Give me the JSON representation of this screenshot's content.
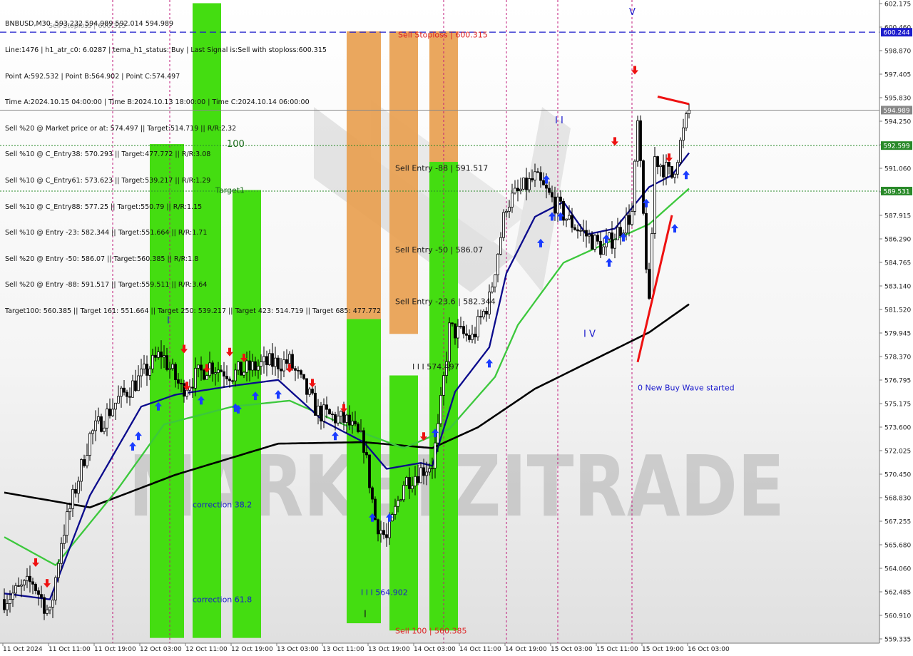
{
  "header": {
    "lines": [
      "BNBUSD,M30  593.232 594.989 592.014 594.989",
      "Line:1476 | h1_atr_c0: 6.0287 | tema_h1_status: Buy | Last Signal is:Sell with stoploss:600.315",
      "Point A:592.532 | Point B:564.902 | Point C:574.497",
      "Time A:2024.10.15 04:00:00 | Time B:2024.10.13 18:00:00 | Time C:2024.10.14 06:00:00",
      "Sell %20 @ Market price or at: 574.497 || Target:514.719 || R/R:2.32",
      "Sell %10 @ C_Entry38: 570.293 || Target:477.772 || R/R:3.08",
      "Sell %10 @ C_Entry61: 573.623 || Target:539.217 || R/R:1.29",
      "Sell %10 @ C_Entry88: 577.25 || Target:550.79 || R/R:1.15",
      "Sell %10 @ Entry -23: 582.344 || Target:551.664 || R/R:1.71",
      "Sell %20 @ Entry -50: 586.07 || Target:560.385 || R/R:1.8",
      "Sell %20 @ Entry -88: 591.517 || Target:559.511 || R/R:3.64",
      "Target100: 560.385 || Target 161: 551.664 || Target 250: 539.217 || Target 423: 514.719 || Target 685: 477.772"
    ],
    "overlay_text": "Sell Stoploss | 600.315"
  },
  "watermark": "MARKETZITRADE",
  "colors": {
    "up": "#000000",
    "down": "#000000",
    "ema_fast": "#0a0a8c",
    "ema_mid": "#3cc83c",
    "ema_slow": "#000000",
    "green_box": "#44dd11",
    "orange_box": "#e8a050",
    "buy_arrow": "#1a3cff",
    "sell_arrow": "#ee1111",
    "hline_blue": "#1c1ccc",
    "hline_green": "#2a8a2a"
  },
  "chart_data": {
    "type": "candlestick",
    "symbol": "BNBUSD",
    "timeframe": "M30",
    "ylim": [
      559.335,
      602.175
    ],
    "y_ticks": [
      "602.175",
      "600.460",
      "598.870",
      "597.405",
      "595.830",
      "594.250",
      "592.635",
      "591.060",
      "589.480",
      "587.915",
      "586.290",
      "584.765",
      "583.140",
      "581.520",
      "579.945",
      "578.370",
      "576.795",
      "575.175",
      "573.600",
      "572.025",
      "570.450",
      "568.830",
      "567.255",
      "565.680",
      "564.060",
      "562.485",
      "560.910",
      "559.335"
    ],
    "x_labels": [
      "11 Oct 2024",
      "11 Oct 11:00",
      "11 Oct 19:00",
      "12 Oct 03:00",
      "12 Oct 11:00",
      "12 Oct 19:00",
      "13 Oct 03:00",
      "13 Oct 11:00",
      "13 Oct 19:00",
      "14 Oct 03:00",
      "14 Oct 11:00",
      "14 Oct 19:00",
      "15 Oct 03:00",
      "15 Oct 11:00",
      "15 Oct 19:00",
      "16 Oct 03:00"
    ],
    "candle_count": 241,
    "price_path": [
      [
        0,
        562.0
      ],
      [
        10,
        563.2
      ],
      [
        16,
        560.9
      ],
      [
        20,
        566.0
      ],
      [
        30,
        573.0
      ],
      [
        40,
        575.5
      ],
      [
        48,
        577.0
      ],
      [
        55,
        578.6
      ],
      [
        62,
        576.2
      ],
      [
        72,
        577.8
      ],
      [
        80,
        577.2
      ],
      [
        92,
        577.9
      ],
      [
        100,
        578.0
      ],
      [
        110,
        574.6
      ],
      [
        120,
        574.0
      ],
      [
        126,
        572.5
      ],
      [
        130,
        567.4
      ],
      [
        134,
        566.0
      ],
      [
        140,
        569.9
      ],
      [
        150,
        571.2
      ],
      [
        152,
        573.4
      ],
      [
        156,
        580.2
      ],
      [
        164,
        579.6
      ],
      [
        170,
        582.2
      ],
      [
        176,
        588.7
      ],
      [
        186,
        590.4
      ],
      [
        198,
        587.5
      ],
      [
        210,
        585.6
      ],
      [
        220,
        588.0
      ],
      [
        222,
        594.0
      ],
      [
        226,
        581.6
      ],
      [
        228,
        591.8
      ],
      [
        234,
        590.5
      ],
      [
        240,
        594.989
      ]
    ],
    "ema_fast": [
      [
        0,
        562.4
      ],
      [
        16,
        562.0
      ],
      [
        30,
        569.0
      ],
      [
        48,
        575.0
      ],
      [
        60,
        575.8
      ],
      [
        80,
        576.4
      ],
      [
        96,
        576.8
      ],
      [
        112,
        574.0
      ],
      [
        126,
        572.6
      ],
      [
        134,
        570.8
      ],
      [
        146,
        571.2
      ],
      [
        150,
        571.0
      ],
      [
        158,
        576.0
      ],
      [
        170,
        579.0
      ],
      [
        176,
        584.0
      ],
      [
        186,
        587.8
      ],
      [
        196,
        588.8
      ],
      [
        204,
        586.6
      ],
      [
        214,
        587.0
      ],
      [
        226,
        589.8
      ],
      [
        234,
        590.6
      ],
      [
        240,
        592.1
      ]
    ],
    "ema_mid": [
      [
        0,
        566.2
      ],
      [
        18,
        564.3
      ],
      [
        40,
        569.5
      ],
      [
        56,
        573.8
      ],
      [
        80,
        575.0
      ],
      [
        100,
        575.4
      ],
      [
        126,
        573.2
      ],
      [
        140,
        572.2
      ],
      [
        156,
        573.5
      ],
      [
        172,
        577.0
      ],
      [
        180,
        580.5
      ],
      [
        196,
        584.7
      ],
      [
        212,
        586.1
      ],
      [
        226,
        587.3
      ],
      [
        240,
        589.7
      ]
    ],
    "ema_slow": [
      [
        0,
        569.2
      ],
      [
        30,
        568.2
      ],
      [
        60,
        570.4
      ],
      [
        96,
        572.5
      ],
      [
        126,
        572.6
      ],
      [
        150,
        572.2
      ],
      [
        166,
        573.6
      ],
      [
        186,
        576.2
      ],
      [
        206,
        578.1
      ],
      [
        226,
        580.0
      ],
      [
        240,
        581.9
      ]
    ],
    "green_boxes": [
      {
        "x0": 51,
        "x1": 63,
        "top": 592.7,
        "bottom": 559.4
      },
      {
        "x0": 66,
        "x1": 76,
        "top": 602.2,
        "bottom": 559.4
      },
      {
        "x0": 80,
        "x1": 90,
        "top": 589.6,
        "bottom": 559.4
      },
      {
        "x0": 120,
        "x1": 132,
        "top": 580.9,
        "bottom": 560.39
      },
      {
        "x0": 135,
        "x1": 145,
        "top": 577.1,
        "bottom": 559.9
      },
      {
        "x0": 149,
        "x1": 159,
        "top": 591.5,
        "bottom": 559.9
      }
    ],
    "orange_boxes": [
      {
        "x0": 120,
        "x1": 132,
        "top": 600.3,
        "bottom": 580.9
      },
      {
        "x0": 135,
        "x1": 145,
        "top": 600.3,
        "bottom": 579.9
      },
      {
        "x0": 149,
        "x1": 159,
        "top": 600.3,
        "bottom": 591.5
      }
    ],
    "hlines": [
      {
        "y": 600.244,
        "label": "600.244",
        "style": "dashed",
        "color": "#1c1ccc"
      },
      {
        "y": 594.989,
        "label": "594.989",
        "style": "solid",
        "color": "#888888"
      },
      {
        "y": 592.599,
        "label": "592.599",
        "style": "dotted",
        "color": "#2a8a2a"
      },
      {
        "y": 589.531,
        "label": "589.531",
        "style": "dotted",
        "color": "#2a8a2a"
      }
    ],
    "vlines_index": [
      38,
      58,
      154,
      176,
      194,
      220
    ],
    "annotations": [
      {
        "text": "Sell Stoploss | 600.315",
        "x": 138,
        "y": 599.9,
        "color": "#dd2222"
      },
      {
        "text": "100",
        "x": 78,
        "y": 592.5,
        "color": "#1a6b1a"
      },
      {
        "text": "Target1",
        "x": 74,
        "y": 589.4,
        "color": "#1a6b1a"
      },
      {
        "text": "Sell Entry -88 | 591.517",
        "x": 137,
        "y": 590.9,
        "color": "#1a1a1a"
      },
      {
        "text": "Sell Entry -50 | 586.07",
        "x": 137,
        "y": 585.4,
        "color": "#1a1a1a"
      },
      {
        "text": "Sell Entry -23.6 | 582.344",
        "x": 137,
        "y": 581.9,
        "color": "#1a1a1a"
      },
      {
        "text": "I I I 574.497",
        "x": 143,
        "y": 577.5,
        "color": "#1a1a1a"
      },
      {
        "text": "correction 38.2",
        "x": 66,
        "y": 568.2,
        "color": "#1a1acc"
      },
      {
        "text": "correction 61.8",
        "x": 66,
        "y": 561.8,
        "color": "#1a1acc"
      },
      {
        "text": "I I I 564.902",
        "x": 125,
        "y": 562.3,
        "color": "#1a1acc"
      },
      {
        "text": "Sell 100 | 560.385",
        "x": 137,
        "y": 559.7,
        "color": "#dd2222"
      },
      {
        "text": "0 New Buy Wave started",
        "x": 222,
        "y": 576.1,
        "color": "#1a1acc"
      },
      {
        "text": "V",
        "x": 219,
        "y": 601.4,
        "color": "#1a1acc"
      },
      {
        "text": "I I",
        "x": 193,
        "y": 594.1,
        "color": "#1a1acc"
      },
      {
        "text": "I V",
        "x": 203,
        "y": 579.7,
        "color": "#1a1acc"
      },
      {
        "text": "I",
        "x": 57,
        "y": 580.6,
        "color": "#1a1acc"
      },
      {
        "text": "I",
        "x": 126,
        "y": 560.8,
        "color": "#1a1a1a"
      }
    ],
    "buy_arrows": [
      [
        45,
        572.9
      ],
      [
        47,
        573.6
      ],
      [
        54,
        575.6
      ],
      [
        69,
        576.0
      ],
      [
        81,
        575.5
      ],
      [
        82,
        575.4
      ],
      [
        88,
        576.3
      ],
      [
        96,
        576.4
      ],
      [
        116,
        573.6
      ],
      [
        129,
        568.1
      ],
      [
        135,
        568.1
      ],
      [
        151,
        573.8
      ],
      [
        170,
        578.5
      ],
      [
        188,
        586.6
      ],
      [
        190,
        590.9
      ],
      [
        192,
        588.4
      ],
      [
        195,
        588.4
      ],
      [
        211,
        586.9
      ],
      [
        212,
        585.3
      ],
      [
        217,
        587.0
      ],
      [
        225,
        589.3
      ],
      [
        235,
        587.6
      ],
      [
        239,
        591.2
      ]
    ],
    "sell_arrows": [
      [
        11,
        563.9
      ],
      [
        15,
        562.5
      ],
      [
        63,
        578.3
      ],
      [
        64,
        575.8
      ],
      [
        71,
        577.0
      ],
      [
        79,
        578.1
      ],
      [
        84,
        577.7
      ],
      [
        100,
        577.0
      ],
      [
        108,
        576.0
      ],
      [
        119,
        574.3
      ],
      [
        147,
        572.4
      ],
      [
        214,
        592.3
      ],
      [
        221,
        597.1
      ],
      [
        233,
        591.2
      ]
    ],
    "red_lines": [
      [
        [
          229,
          595.9
        ],
        [
          240,
          595.4
        ]
      ],
      [
        [
          222,
          578.0
        ],
        [
          234,
          587.9
        ]
      ]
    ]
  }
}
